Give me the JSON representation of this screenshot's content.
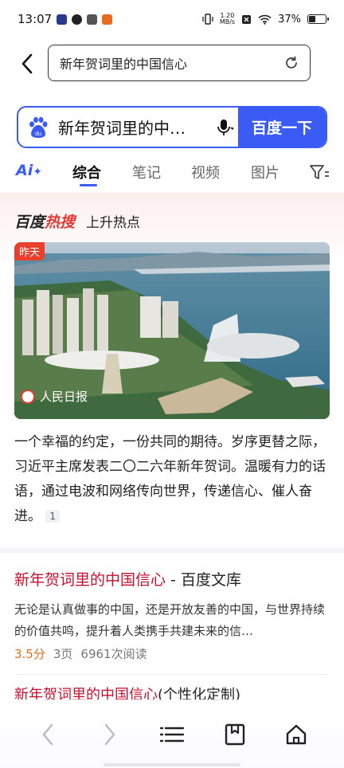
{
  "status_bar": {
    "time": "13:07",
    "net_speed_value": "1.20",
    "net_speed_unit": "MB/s",
    "battery": "37%",
    "battery_level": 0.37
  },
  "url_bar": {
    "text": "新年贺词里的中国信心"
  },
  "search": {
    "query": "新年贺词里的中…",
    "button_label": "百度一下"
  },
  "tabs": {
    "ai": "Ai",
    "items": [
      "综合",
      "笔记",
      "视频",
      "图片"
    ],
    "active": "综合"
  },
  "hot": {
    "logo_a": "百度",
    "logo_b": "热搜",
    "subtitle": "上升热点",
    "badge": "昨天",
    "source": "人民日报",
    "summary": "一个幸福的约定，一份共同的期待。岁序更替之际，习近平主席发表二〇二六年新年贺词。温暖有力的话语，通过电波和网络传向世界，传递信心、催人奋进。",
    "ref": "1"
  },
  "result1": {
    "title_highlight": "新年贺词里的中国信心",
    "title_suffix": " - 百度文库",
    "description": "无论是认真做事的中国，还是开放友善的中国，与世界持续的价值共鸣，提升着人类携手共建未来的信…",
    "score": "3.5分",
    "pages": "3页",
    "reads": "6961次阅读"
  },
  "result2": {
    "title_highlight": "新年贺词里的中国信心",
    "title_suffix": "(个性化定制)"
  },
  "colors": {
    "accent": "#3a5cf5",
    "hot_red": "#e33b35",
    "title_red": "#c8102e"
  }
}
